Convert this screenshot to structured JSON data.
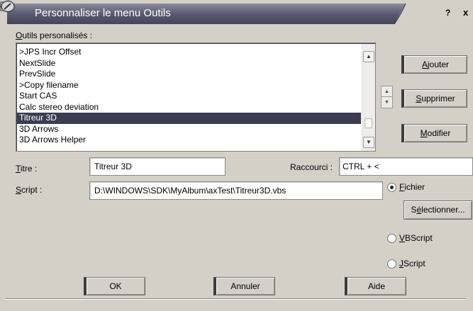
{
  "window": {
    "title": "Personnaliser le menu Outils",
    "help_label": "?",
    "close_label": "x"
  },
  "tools_list": {
    "label_mnemonic": "O",
    "label_rest": "utils personalisés :",
    "items": [
      ">JPS Incr Offset",
      "NextSlide",
      "PrevSlide",
      ">Copy filename",
      "Start CAS",
      "Calc stereo deviation",
      "Titreur 3D",
      "3D Arrows",
      "3D Arrows Helper"
    ],
    "selected": "Titreur 3D"
  },
  "buttons": {
    "add": {
      "mnemonic": "A",
      "rest": "jouter"
    },
    "delete": {
      "mnemonic": "S",
      "rest": "upprimer"
    },
    "modify": {
      "mnemonic": "M",
      "rest": "odifier"
    },
    "select": {
      "pre": "S",
      "mnemonic": "é",
      "rest": "lectionner..."
    },
    "ok": "OK",
    "cancel": "Annuler",
    "help": "Aide"
  },
  "form": {
    "title_label": {
      "mnemonic": "T",
      "rest": "itre :"
    },
    "title_value": "Titreur 3D",
    "shortcut_label": "Raccourci :",
    "shortcut_value": "CTRL + <",
    "script_label": {
      "mnemonic": "S",
      "rest": "cript :"
    },
    "script_value": "D:\\WINDOWS\\SDK\\MyAlbum\\axTest\\Titreur3D.vbs"
  },
  "script_type": {
    "options": [
      {
        "mnemonic": "F",
        "rest": "ichier",
        "checked": true
      },
      {
        "mnemonic": "V",
        "rest": "BScript",
        "checked": false
      },
      {
        "mnemonic": "J",
        "rest": "Script",
        "checked": false
      }
    ]
  }
}
